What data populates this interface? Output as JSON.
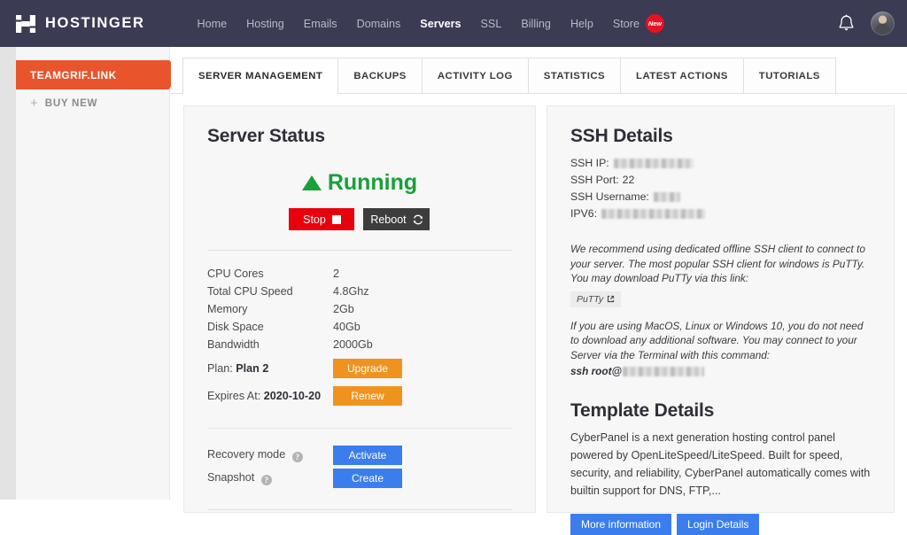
{
  "header": {
    "brand": "HOSTINGER",
    "nav_items": [
      {
        "label": "Home",
        "active": false
      },
      {
        "label": "Hosting",
        "active": false
      },
      {
        "label": "Emails",
        "active": false
      },
      {
        "label": "Domains",
        "active": false
      },
      {
        "label": "Servers",
        "active": true
      },
      {
        "label": "SSL",
        "active": false
      },
      {
        "label": "Billing",
        "active": false
      },
      {
        "label": "Help",
        "active": false
      }
    ],
    "store_label": "Store",
    "store_badge": "New",
    "bell_icon": "bell-icon",
    "avatar_icon": "user-avatar"
  },
  "sidebar": {
    "active_item": "TEAMGRIF.LINK",
    "buy_new": "BUY NEW",
    "plus_icon": "plus-icon"
  },
  "tabs": [
    {
      "label": "SERVER MANAGEMENT",
      "active": true
    },
    {
      "label": "BACKUPS",
      "active": false
    },
    {
      "label": "ACTIVITY LOG",
      "active": false
    },
    {
      "label": "STATISTICS",
      "active": false
    },
    {
      "label": "LATEST ACTIONS",
      "active": false
    },
    {
      "label": "TUTORIALS",
      "active": false
    }
  ],
  "server_status": {
    "title": "Server Status",
    "status_text": "Running",
    "status_color": "#18a03a",
    "status_icon": "triangle-up-icon",
    "stop_label": "Stop",
    "stop_icon": "square-stop-icon",
    "stop_color": "#e8000d",
    "reboot_label": "Reboot",
    "reboot_icon": "refresh-icon",
    "reboot_color": "#3d3d3d",
    "specs": [
      {
        "key": "CPU Cores",
        "value": "2"
      },
      {
        "key": "Total CPU Speed",
        "value": "4.8Ghz"
      },
      {
        "key": "Memory",
        "value": "2Gb"
      },
      {
        "key": "Disk Space",
        "value": "40Gb"
      },
      {
        "key": "Bandwidth",
        "value": "2000Gb"
      }
    ],
    "plan_label": "Plan:",
    "plan_value": "Plan 2",
    "upgrade_label": "Upgrade",
    "expires_label": "Expires At:",
    "expires_value": "2020-10-20",
    "renew_label": "Renew",
    "orange_button_color": "#f0931e",
    "recovery_label": "Recovery mode",
    "recovery_button": "Activate",
    "snapshot_label": "Snapshot",
    "snapshot_button": "Create",
    "help_icon": "help-icon",
    "blue_button_color": "#3b7ded"
  },
  "ssh_details": {
    "title": "SSH Details",
    "ip_label": "SSH IP:",
    "ip_value": "",
    "port_label": "SSH Port:",
    "port_value": "22",
    "username_label": "SSH Username:",
    "username_value": "",
    "ipv6_label": "IPV6:",
    "ipv6_value": "",
    "note_windows": "We recommend using dedicated offline SSH client to connect to your server. The most popular SSH client for windows is PuTTy. You may download PuTTy via this link:",
    "putty_label": "PuTTy",
    "putty_icon": "external-link-icon",
    "note_unix": "If you are using MacOS, Linux or Windows 10, you do not need to download any additional software. You may connect to your Server via the Terminal with this command:",
    "command_prefix": "ssh root@"
  },
  "template_details": {
    "title": "Template Details",
    "description": "CyberPanel is a next generation hosting control panel powered by OpenLiteSpeed/LiteSpeed. Built for speed, security, and reliability, CyberPanel automatically comes with builtin support for DNS, FTP,...",
    "more_info_label": "More information",
    "login_details_label": "Login Details"
  }
}
